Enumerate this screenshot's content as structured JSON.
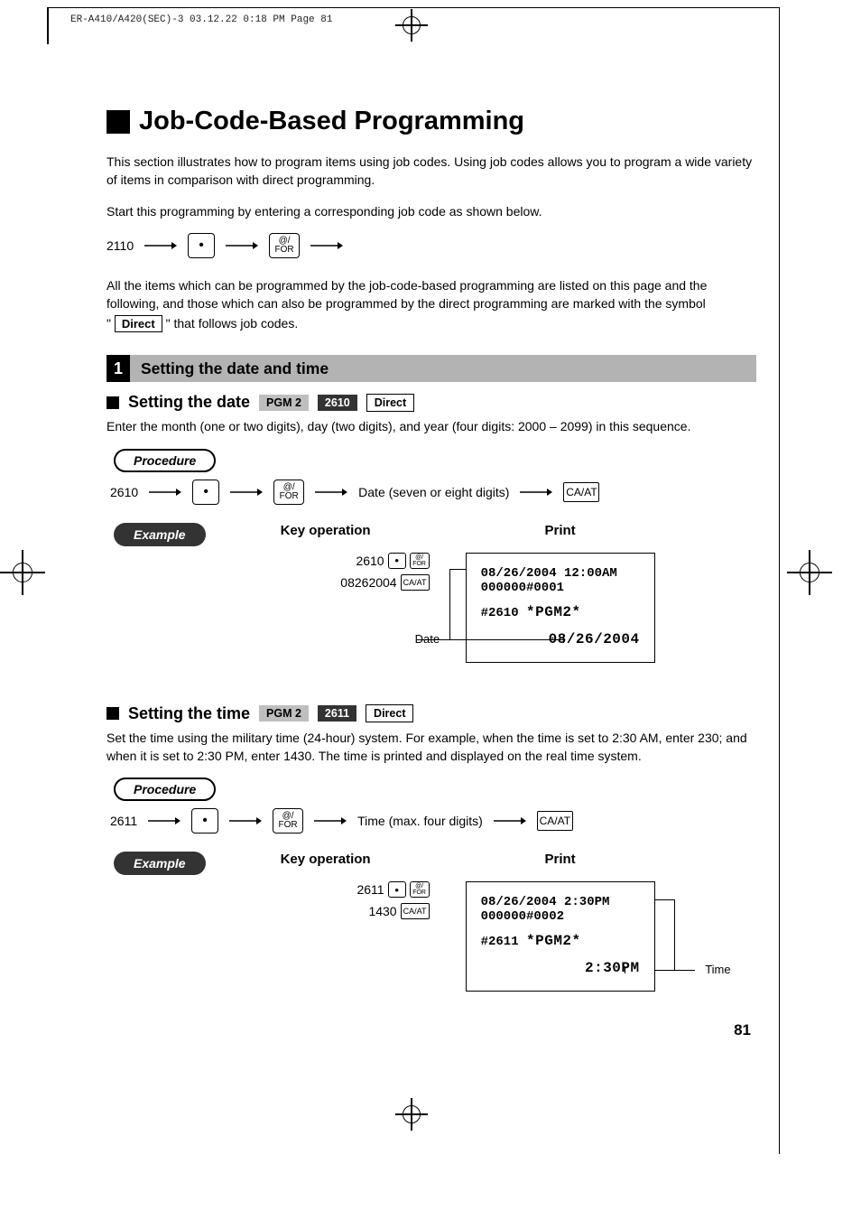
{
  "header": {
    "runline": "ER-A410/A420(SEC)-3  03.12.22 0:18 PM  Page 81"
  },
  "title": "Job-Code-Based Programming",
  "intro1": "This section illustrates how to program items using job codes. Using job codes allows you to program a wide variety of items in comparison with direct programming.",
  "intro2": "Start this programming by entering a corresponding job code as shown below.",
  "top_seq_code": "2110",
  "key_dot": "•",
  "key_at_top": "@/",
  "key_at_bot": "FOR",
  "intro3a": "All the items which can be programmed by the job-code-based programming are listed on this page and the following, and those which can also be programmed by the direct programming are marked with the symbol",
  "intro3b": "\" that follows job codes.",
  "intro3_open_quote": "\" ",
  "direct_label": "Direct",
  "section1": {
    "num": "1",
    "title": "Setting the date and time"
  },
  "date": {
    "heading": "Setting the date",
    "chip_pgm": "PGM 2",
    "chip_code": "2610",
    "chip_direct": "Direct",
    "explain": "Enter the month (one or two digits), day (two digits), and year (four digits: 2000 – 2099) in this sequence.",
    "procedure_label": "Procedure",
    "seq_code": "2610",
    "seq_mid": "Date (seven or eight digits)",
    "caat": "CA/AT",
    "example_label": "Example",
    "key_op_label": "Key operation",
    "print_label": "Print",
    "key_line1_code": "2610",
    "key_line2_code": "08262004",
    "callout": "Date",
    "receipt": {
      "l1": "08/26/2004 12:00AM",
      "l2": "000000#0001",
      "l3a": "#2610 ",
      "l3b": "*PGM2*",
      "l4": "08/26/2004"
    }
  },
  "time": {
    "heading": "Setting the time",
    "chip_pgm": "PGM 2",
    "chip_code": "2611",
    "chip_direct": "Direct",
    "explain": "Set the time using the military time (24-hour) system.  For example, when the time is set to 2:30 AM, enter 230; and when it is set to 2:30 PM, enter 1430. The time is printed and displayed on the real time system.",
    "procedure_label": "Procedure",
    "seq_code": "2611",
    "seq_mid": "Time (max. four digits)",
    "caat": "CA/AT",
    "example_label": "Example",
    "key_op_label": "Key operation",
    "print_label": "Print",
    "key_line1_code": "2611",
    "key_line2_code": "1430",
    "callout": "Time",
    "receipt": {
      "l1": "08/26/2004  2:30PM",
      "l2": "000000#0002",
      "l3a": "#2611 ",
      "l3b": "*PGM2*",
      "l4": "2:30PM"
    }
  },
  "page_number": "81"
}
